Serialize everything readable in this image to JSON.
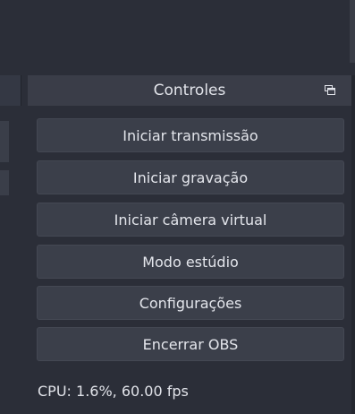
{
  "controls_dock": {
    "title": "Controles",
    "float_icon": "float-dock-icon",
    "buttons": [
      {
        "label": "Iniciar transmissão"
      },
      {
        "label": "Iniciar gravação"
      },
      {
        "label": "Iniciar câmera virtual"
      },
      {
        "label": "Modo estúdio"
      },
      {
        "label": "Configurações"
      },
      {
        "label": "Encerrar OBS"
      }
    ]
  },
  "status_bar": {
    "cpu_text": "CPU: 1.6%, 60.00 fps"
  }
}
